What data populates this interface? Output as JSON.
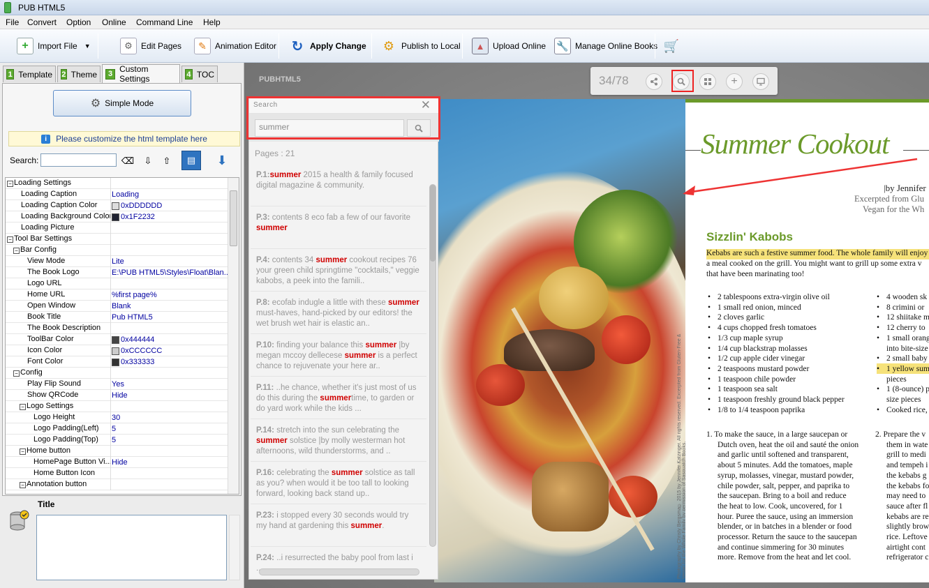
{
  "app": {
    "title": "PUB HTML5"
  },
  "menu": [
    "File",
    "Convert",
    "Option",
    "Online",
    "Command Line",
    "Help"
  ],
  "toolbar": {
    "import_file": "Import File",
    "edit_pages": "Edit Pages",
    "animation_editor": "Animation Editor",
    "apply_change": "Apply Change",
    "publish_local": "Publish to Local",
    "upload_online": "Upload Online",
    "manage_books": "Manage Online Books"
  },
  "tabs": [
    {
      "num": "1",
      "label": "Template"
    },
    {
      "num": "2",
      "label": "Theme"
    },
    {
      "num": "3",
      "label": "Custom Settings"
    },
    {
      "num": "4",
      "label": "TOC"
    }
  ],
  "settings": {
    "simple_mode": "Simple Mode",
    "info": "Please customize the html template here",
    "search_label": "Search:",
    "search_value": ""
  },
  "properties": [
    {
      "label": "Loading Settings",
      "value": "",
      "level": 0,
      "group": true
    },
    {
      "label": "Loading Caption",
      "value": "Loading",
      "level": 1
    },
    {
      "label": "Loading Caption Color",
      "value": "0xDDDDDD",
      "level": 1,
      "swatch": "#dddddd"
    },
    {
      "label": "Loading Background Color",
      "value": "0x1F2232",
      "level": 1,
      "swatch": "#1f2232"
    },
    {
      "label": "Loading Picture",
      "value": "",
      "level": 1
    },
    {
      "label": "Tool Bar Settings",
      "value": "",
      "level": 0,
      "group": true
    },
    {
      "label": "Bar Config",
      "value": "",
      "level": 1,
      "group": true
    },
    {
      "label": "View Mode",
      "value": "Lite",
      "level": 2
    },
    {
      "label": "The Book Logo",
      "value": "E:\\PUB HTML5\\Styles\\Float\\Blan...",
      "level": 2
    },
    {
      "label": "Logo URL",
      "value": "",
      "level": 2
    },
    {
      "label": "Home URL",
      "value": "%first page%",
      "level": 2
    },
    {
      "label": "Open Window",
      "value": "Blank",
      "level": 2
    },
    {
      "label": "Book Title",
      "value": "Pub HTML5",
      "level": 2
    },
    {
      "label": "The Book Description",
      "value": "",
      "level": 2
    },
    {
      "label": "ToolBar Color",
      "value": "0x444444",
      "level": 2,
      "swatch": "#444444"
    },
    {
      "label": "Icon Color",
      "value": "0xCCCCCC",
      "level": 2,
      "swatch": "#cccccc"
    },
    {
      "label": "Font Color",
      "value": "0x333333",
      "level": 2,
      "swatch": "#333333"
    },
    {
      "label": "Config",
      "value": "",
      "level": 1,
      "group": true
    },
    {
      "label": "Play Flip Sound",
      "value": "Yes",
      "level": 2
    },
    {
      "label": "Show QRCode",
      "value": "Hide",
      "level": 2
    },
    {
      "label": "Logo Settings",
      "value": "",
      "level": 2,
      "group": true
    },
    {
      "label": "Logo Height",
      "value": "30",
      "level": 3
    },
    {
      "label": "Logo Padding(Left)",
      "value": "5",
      "level": 3
    },
    {
      "label": "Logo Padding(Top)",
      "value": "5",
      "level": 3
    },
    {
      "label": "Home button",
      "value": "",
      "level": 2,
      "group": true
    },
    {
      "label": "HomePage Button Vi...",
      "value": "Hide",
      "level": 3
    },
    {
      "label": "Home Button Icon",
      "value": "",
      "level": 3
    },
    {
      "label": "Annotation button",
      "value": "",
      "level": 2,
      "group": true
    }
  ],
  "title_section": {
    "label": "Title",
    "value": ""
  },
  "viewer": {
    "logo": "PUBHTML5",
    "page_count": "34/78",
    "search_panel": {
      "header": "Search",
      "query": "summer",
      "pages_info": "Pages : 21",
      "results": [
        {
          "page": "P.1:",
          "parts": [
            "",
            "summer",
            " 2015 a health & family focused digital magazine & community."
          ]
        },
        {
          "page": "P.3:",
          "parts": [
            " contents 8 eco fab a few of our favorite ",
            "summer",
            ""
          ]
        },
        {
          "page": "P.4:",
          "parts": [
            " contents 34 ",
            "summer",
            " cookout recipes 76 your green child springtime \"cocktails,\" veggie kabobs, a peek into the famili.."
          ]
        },
        {
          "page": "P.8:",
          "parts": [
            " ecofab indugle a little with these ",
            "summer",
            " must-haves, hand-picked by our editors! the wet brush wet hair is elastic an.."
          ]
        },
        {
          "page": "P.10:",
          "parts": [
            " finding your balance this ",
            "summer",
            " |by megan mccoy dellecese ",
            "summer",
            " is a perfect chance to rejuvenate your here ar.."
          ]
        },
        {
          "page": "P.11:",
          "parts": [
            " ..he chance, whether it's just most of us do this during the ",
            "summer",
            "time, to garden or do yard work while the kids ..."
          ]
        },
        {
          "page": "P.14:",
          "parts": [
            " stretch into the sun celebrating the ",
            "summer",
            " solstice |by molly westerman hot afternoons, wild thunderstorms, and .."
          ]
        },
        {
          "page": "P.16:",
          "parts": [
            " celebrating the ",
            "summer",
            " solstice as tall as you? when would it be too tall to looking forward, looking back stand up.."
          ]
        },
        {
          "page": "P.23:",
          "parts": [
            " i stopped every 30 seconds would try my hand at gardening this ",
            "summer",
            "."
          ]
        },
        {
          "page": "P.24:",
          "parts": [
            " ..i resurrected the baby pool from last i ...",
            "",
            ""
          ]
        }
      ]
    },
    "right_page": {
      "title": "Summer Cookout",
      "byline": "|by Jennifer",
      "excerpt1": "Excerpted from Glu",
      "excerpt2": "Vegan for the Wh",
      "heading": "Sizzlin' Kabobs",
      "intro": [
        "Kebabs are such a festive summer food. The whole family will enjoy",
        "a meal cooked on the grill. You might want to grill up some extra v",
        "that have been marinating too!"
      ],
      "ingredients_left": [
        "2 tablespoons extra-virgin olive oil",
        "1 small red onion, minced",
        "2 cloves garlic",
        "4 cups chopped fresh tomatoes",
        "1/3 cup maple syrup",
        "1/4 cup blackstrap molasses",
        "1/2 cup apple cider vinegar",
        "2 teaspoons mustard powder",
        "1 teaspoon chile powder",
        "1 teaspoon sea salt",
        "1 teaspoon freshly ground black pepper",
        "1/8 to 1/4 teaspoon paprika"
      ],
      "ingredients_right": [
        "4 wooden sk",
        "8 crimini or",
        "12 shiitake m",
        "12 cherry to",
        "1 small orang",
        "into bite-size",
        "2 small baby",
        "1 yellow sum",
        "pieces",
        "1 (8-ounce) p",
        "size pieces",
        "Cooked rice,"
      ],
      "step1": [
        "1.  To make the sauce, in a large saucepan or",
        "Dutch oven, heat the oil and sauté the onion",
        "and garlic until softened and transparent,",
        "about 5 minutes. Add the tomatoes, maple",
        "syrup, molasses, vinegar, mustard powder,",
        "chile powder, salt, pepper, and paprika to",
        "the saucepan. Bring to a boil and reduce",
        "the heat to low. Cook, uncovered, for 1",
        "hour. Puree the sauce, using an immersion",
        "blender, or in batches in a blender or food",
        "processor. Return the sauce to the saucepan",
        "and continue simmering for 30 minutes",
        "more. Remove from the heat and let cool."
      ],
      "step2": [
        "2.  Prepare the v",
        "them in wate",
        "grill to medi",
        "and tempeh i",
        "the kebabs g",
        "the kebabs fo",
        "may need to",
        "sauce after fl",
        "kebabs are re",
        "slightly brow",
        "rice. Leftove",
        "airtight cont",
        "refrigerator c"
      ]
    },
    "photo_credit": "Photography by Christy Bergsma© 2015 by Jennifer Katzinger. All rights reserved. Excerpted from Gluten-Free & Vegan for the Whole Family by permission of Sasquatch Books."
  }
}
